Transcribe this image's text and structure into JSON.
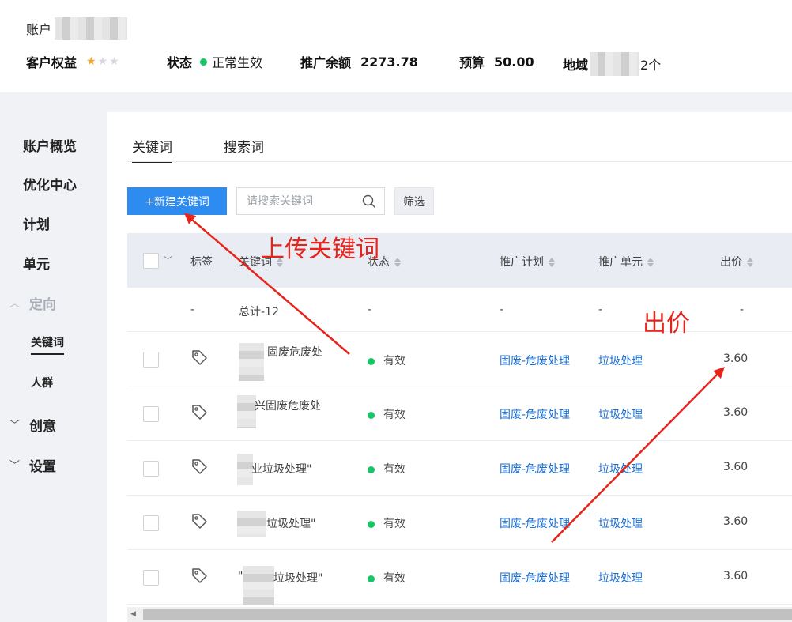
{
  "header": {
    "account_label": "账户",
    "rights_label": "客户权益",
    "rating": 1,
    "rating_max": 3,
    "status_label": "状态",
    "status_value": "正常生效",
    "balance_label": "推广余额",
    "balance_value": "2273.78",
    "budget_label": "预算",
    "budget_value": "50.00",
    "region_label": "地域",
    "region_suffix": "2个"
  },
  "sidebar": {
    "items": [
      {
        "label": "账户概览"
      },
      {
        "label": "优化中心"
      },
      {
        "label": "计划"
      },
      {
        "label": "单元"
      },
      {
        "label": "定向"
      },
      {
        "label": "关键词"
      },
      {
        "label": "人群"
      },
      {
        "label": "创意"
      },
      {
        "label": "设置"
      }
    ]
  },
  "tabs": [
    {
      "label": "关键词",
      "active": true
    },
    {
      "label": "搜索词",
      "active": false
    }
  ],
  "toolbar": {
    "new_keyword_label": "+新建关键词",
    "search_placeholder": "请搜索关键词",
    "filter_label": "筛选"
  },
  "table": {
    "columns": [
      "标签",
      "关键词",
      "状态",
      "推广计划",
      "推广单元",
      "出价"
    ],
    "total_row": {
      "label_col": "-",
      "keyword": "总计-12",
      "status": "-",
      "plan": "-",
      "unit": "-",
      "bid": "-"
    },
    "rows": [
      {
        "keyword_line1": "固废危废处",
        "keyword_line2": "",
        "status": "有效",
        "plan": "固废-危废处理",
        "unit": "垃圾处理",
        "bid": "3.60"
      },
      {
        "keyword_line1": "兴固废危废处",
        "keyword_line2": "",
        "status": "有效",
        "plan": "固废-危废处理",
        "unit": "垃圾处理",
        "bid": "3.60"
      },
      {
        "keyword_line1": "业垃圾处理\"",
        "keyword_line2": "",
        "status": "有效",
        "plan": "固废-危废处理",
        "unit": "垃圾处理",
        "bid": "3.60"
      },
      {
        "keyword_line1": "垃圾处理\"",
        "keyword_line2": "",
        "status": "有效",
        "plan": "固废-危废处理",
        "unit": "垃圾处理",
        "bid": "3.60"
      },
      {
        "keyword_line1": "\"",
        "keyword_line2": "垃圾处理\"",
        "status": "有效",
        "plan": "固废-危废处理",
        "unit": "垃圾处理",
        "bid": "3.60"
      }
    ]
  },
  "annotations": {
    "upload_note": "上传关键词",
    "bid_note": "出价",
    "color": "#e8231a"
  },
  "colors": {
    "primary": "#2e8cf0",
    "link": "#1a6fd4",
    "status_green": "#17c566",
    "star": "#f5a623"
  }
}
